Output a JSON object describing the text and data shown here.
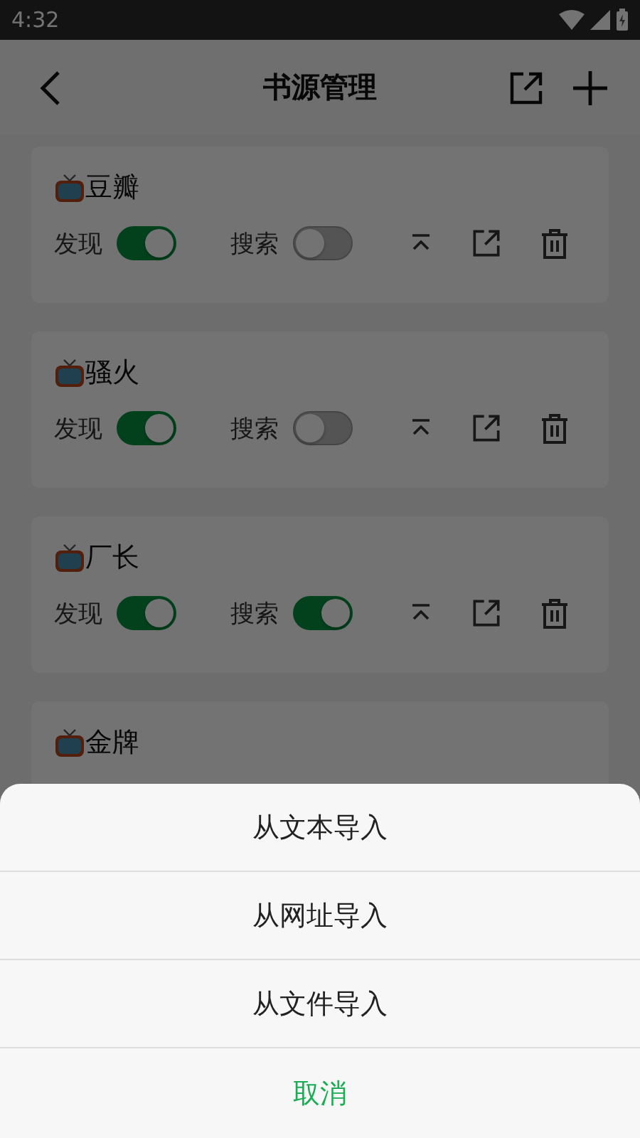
{
  "status_bar": {
    "time": "4:32"
  },
  "app_bar": {
    "title": "书源管理"
  },
  "sources": [
    {
      "name": "豆瓣",
      "discover": {
        "label": "发现",
        "on": true
      },
      "search": {
        "label": "搜索",
        "on": false
      }
    },
    {
      "name": "骚火",
      "discover": {
        "label": "发现",
        "on": true
      },
      "search": {
        "label": "搜索",
        "on": false
      }
    },
    {
      "name": "厂长",
      "discover": {
        "label": "发现",
        "on": true
      },
      "search": {
        "label": "搜索",
        "on": true
      }
    },
    {
      "name": "金牌"
    }
  ],
  "action_sheet": {
    "options": [
      "从文本导入",
      "从网址导入",
      "从文件导入"
    ],
    "cancel": "取消"
  }
}
